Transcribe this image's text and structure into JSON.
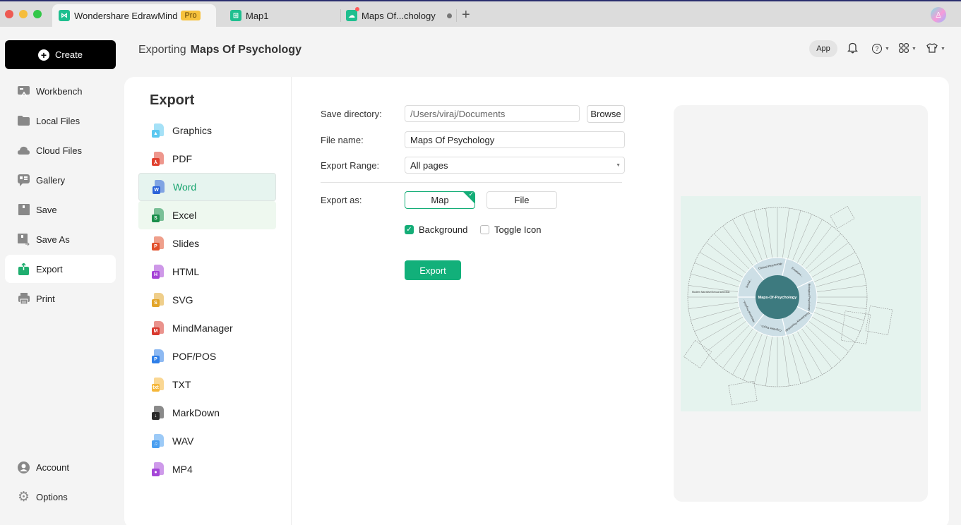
{
  "titlebar": {
    "tabs": [
      {
        "label": "Wondershare EdrawMind",
        "badge": "Pro",
        "active": true
      },
      {
        "label": "Map1",
        "active": false
      },
      {
        "label": "Maps Of...chology",
        "active": false,
        "unsaved": true
      }
    ],
    "new_tab_label": "+"
  },
  "sidebar": {
    "create_label": "Create",
    "items": [
      {
        "label": "Workbench",
        "icon": "workbench-icon"
      },
      {
        "label": "Local Files",
        "icon": "folder-icon"
      },
      {
        "label": "Cloud Files",
        "icon": "cloud-icon"
      },
      {
        "label": "Gallery",
        "icon": "gallery-icon"
      },
      {
        "label": "Save",
        "icon": "save-icon"
      },
      {
        "label": "Save As",
        "icon": "save-as-icon"
      },
      {
        "label": "Export",
        "icon": "export-icon",
        "active": true
      },
      {
        "label": "Print",
        "icon": "print-icon"
      }
    ],
    "bottom_items": [
      {
        "label": "Account",
        "icon": "account-icon"
      },
      {
        "label": "Options",
        "icon": "gear-icon"
      }
    ]
  },
  "header": {
    "prefix": "Exporting",
    "title": "Maps Of Psychology",
    "app_label": "App"
  },
  "export": {
    "title": "Export",
    "formats": [
      {
        "label": "Graphics",
        "color": "#5bc8f0",
        "badge": "▲"
      },
      {
        "label": "PDF",
        "color": "#e0412f",
        "badge": "⅄"
      },
      {
        "label": "Word",
        "color": "#2b63d9",
        "badge": "W",
        "selected": true
      },
      {
        "label": "Excel",
        "color": "#1a8f4c",
        "badge": "S",
        "hover": true
      },
      {
        "label": "Slides",
        "color": "#e2502c",
        "badge": "P"
      },
      {
        "label": "HTML",
        "color": "#a543d6",
        "badge": "H"
      },
      {
        "label": "SVG",
        "color": "#e2a52a",
        "badge": "S"
      },
      {
        "label": "MindManager",
        "color": "#d93a2f",
        "badge": "M"
      },
      {
        "label": "POF/POS",
        "color": "#2f7fe8",
        "badge": "P"
      },
      {
        "label": "TXT",
        "color": "#f5b73b",
        "badge": "txt"
      },
      {
        "label": "MarkDown",
        "color": "#2a2a2a",
        "badge": "↓"
      },
      {
        "label": "WAV",
        "color": "#4a9ff0",
        "badge": "♫"
      },
      {
        "label": "MP4",
        "color": "#a547d8",
        "badge": "●"
      }
    ]
  },
  "form": {
    "save_directory_label": "Save directory:",
    "save_directory_value": "/Users/viraj/Documents",
    "browse_label": "Browse",
    "file_name_label": "File name:",
    "file_name_value": "Maps Of Psychology",
    "export_range_label": "Export Range:",
    "export_range_value": "All pages",
    "export_as_label": "Export as:",
    "export_as_options": [
      "Map",
      "File"
    ],
    "export_as_selected": "Map",
    "background_label": "Background",
    "background_checked": true,
    "toggle_icon_label": "Toggle Icon",
    "toggle_icon_checked": false,
    "export_button_label": "Export"
  },
  "preview": {
    "center_label": "Maps-Of-Psychology",
    "inner_ring": [
      "Clinical Psychology",
      "Emotions...",
      "Biological Psychology",
      "Evolutionary Psychology",
      "Cognitive Psych...",
      "Abnormal Psychol...",
      "Social..."
    ],
    "side_label": "Modern Narrative/Sexual selection",
    "colors": {
      "center": "#3d7a7f",
      "ring": "#cddfe6",
      "background": "#e5f3ee"
    }
  },
  "colors": {
    "accent": "#14ad77",
    "selected_bg": "#e6f4ef",
    "titlebar": "#dcdcdc"
  }
}
